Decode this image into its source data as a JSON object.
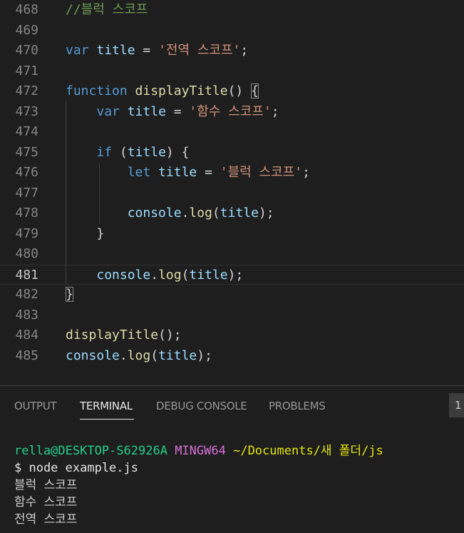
{
  "editor": {
    "lines": [
      {
        "num": "468",
        "tokens": [
          {
            "t": "//블럭 스코프",
            "c": "comment"
          }
        ]
      },
      {
        "num": "469",
        "tokens": []
      },
      {
        "num": "470",
        "tokens": [
          {
            "t": "var",
            "c": "keyword"
          },
          {
            "t": " ",
            "c": "plain"
          },
          {
            "t": "title",
            "c": "var"
          },
          {
            "t": " = ",
            "c": "plain"
          },
          {
            "t": "'전역 스코프'",
            "c": "string"
          },
          {
            "t": ";",
            "c": "plain"
          }
        ]
      },
      {
        "num": "471",
        "tokens": []
      },
      {
        "num": "472",
        "tokens": [
          {
            "t": "function",
            "c": "keyword"
          },
          {
            "t": " ",
            "c": "plain"
          },
          {
            "t": "displayTitle",
            "c": "func"
          },
          {
            "t": "() ",
            "c": "plain"
          },
          {
            "t": "{",
            "c": "plain",
            "box": true
          }
        ]
      },
      {
        "num": "473",
        "tokens": [
          {
            "t": "    ",
            "c": "plain"
          },
          {
            "t": "var",
            "c": "keyword"
          },
          {
            "t": " ",
            "c": "plain"
          },
          {
            "t": "title",
            "c": "var"
          },
          {
            "t": " = ",
            "c": "plain"
          },
          {
            "t": "'함수 스코프'",
            "c": "string"
          },
          {
            "t": ";",
            "c": "plain"
          }
        ]
      },
      {
        "num": "474",
        "tokens": []
      },
      {
        "num": "475",
        "tokens": [
          {
            "t": "    ",
            "c": "plain"
          },
          {
            "t": "if",
            "c": "keyword"
          },
          {
            "t": " (",
            "c": "plain"
          },
          {
            "t": "title",
            "c": "var"
          },
          {
            "t": ") {",
            "c": "plain"
          }
        ]
      },
      {
        "num": "476",
        "tokens": [
          {
            "t": "        ",
            "c": "plain"
          },
          {
            "t": "let",
            "c": "keyword"
          },
          {
            "t": " ",
            "c": "plain"
          },
          {
            "t": "title",
            "c": "var"
          },
          {
            "t": " = ",
            "c": "plain"
          },
          {
            "t": "'블럭 스코프'",
            "c": "string"
          },
          {
            "t": ";",
            "c": "plain"
          }
        ]
      },
      {
        "num": "477",
        "tokens": []
      },
      {
        "num": "478",
        "tokens": [
          {
            "t": "        ",
            "c": "plain"
          },
          {
            "t": "console",
            "c": "var"
          },
          {
            "t": ".",
            "c": "plain"
          },
          {
            "t": "log",
            "c": "func"
          },
          {
            "t": "(",
            "c": "plain"
          },
          {
            "t": "title",
            "c": "var"
          },
          {
            "t": ");",
            "c": "plain"
          }
        ]
      },
      {
        "num": "479",
        "tokens": [
          {
            "t": "    }",
            "c": "plain"
          }
        ]
      },
      {
        "num": "480",
        "tokens": []
      },
      {
        "num": "481",
        "tokens": [
          {
            "t": "    ",
            "c": "plain"
          },
          {
            "t": "console",
            "c": "var"
          },
          {
            "t": ".",
            "c": "plain"
          },
          {
            "t": "log",
            "c": "func"
          },
          {
            "t": "(",
            "c": "plain"
          },
          {
            "t": "title",
            "c": "var"
          },
          {
            "t": ");",
            "c": "plain"
          }
        ],
        "current": true
      },
      {
        "num": "482",
        "tokens": [
          {
            "t": "}",
            "c": "plain",
            "box": true
          }
        ]
      },
      {
        "num": "483",
        "tokens": []
      },
      {
        "num": "484",
        "tokens": [
          {
            "t": "displayTitle",
            "c": "func"
          },
          {
            "t": "();",
            "c": "plain"
          }
        ]
      },
      {
        "num": "485",
        "tokens": [
          {
            "t": "console",
            "c": "var"
          },
          {
            "t": ".",
            "c": "plain"
          },
          {
            "t": "log",
            "c": "func"
          },
          {
            "t": "(",
            "c": "plain"
          },
          {
            "t": "title",
            "c": "var"
          },
          {
            "t": ");",
            "c": "plain"
          }
        ]
      }
    ]
  },
  "panel": {
    "tabs": [
      {
        "label": "OUTPUT",
        "active": false
      },
      {
        "label": "TERMINAL",
        "active": true
      },
      {
        "label": "DEBUG CONSOLE",
        "active": false
      },
      {
        "label": "PROBLEMS",
        "active": false
      }
    ],
    "terminal_selector": "1"
  },
  "terminal": {
    "prompt_user": "rella@DESKTOP-S62926A",
    "prompt_env": "MINGW64",
    "prompt_path": "~/Documents/새 폴더/js",
    "command": "$ node example.js",
    "output": [
      "블럭 스코프",
      "함수 스코프",
      "전역 스코프"
    ]
  },
  "colors": {
    "background": "#1e1e1e",
    "comment": "#6a9955",
    "keyword": "#569cd6",
    "variable": "#9cdcfe",
    "function": "#dcdcaa",
    "string": "#ce9178",
    "prompt_green": "#23d18b",
    "prompt_magenta": "#d670d6",
    "prompt_yellow": "#e5e510"
  }
}
